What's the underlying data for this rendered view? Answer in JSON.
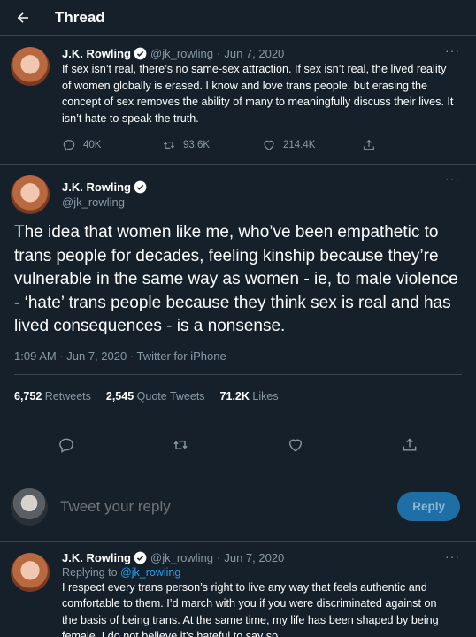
{
  "header": {
    "title": "Thread"
  },
  "tweet1": {
    "name": "J.K. Rowling",
    "handle": "@jk_rowling",
    "dot": "·",
    "date": "Jun 7, 2020",
    "text": "If sex isn’t real, there’s no same-sex attraction. If sex isn’t real, the lived reality of women globally is erased. I know and love trans people, but erasing the concept of sex removes the ability of many to meaningfully discuss their lives. It isn’t hate to speak the truth.",
    "replies": "40K",
    "retweets": "93.6K",
    "likes": "214.4K"
  },
  "tweet2": {
    "name": "J.K. Rowling",
    "handle": "@jk_rowling",
    "text": "The idea that women like me, who’ve been empathetic to trans people for decades, feeling kinship because they’re vulnerable in the same way as women - ie, to male violence - ‘hate’ trans people because they think sex is real and has lived consequences - is a nonsense.",
    "meta": "1:09 AM · Jun 7, 2020 · Twitter for iPhone",
    "retweets_count": "6,752",
    "retweets_label": "Retweets",
    "quotes_count": "2,545",
    "quotes_label": "Quote Tweets",
    "likes_count": "71.2K",
    "likes_label": "Likes"
  },
  "reply": {
    "placeholder": "Tweet your reply",
    "button": "Reply"
  },
  "tweet3": {
    "name": "J.K. Rowling",
    "handle": "@jk_rowling",
    "dot": "·",
    "date": "Jun 7, 2020",
    "replying_prefix": "Replying to",
    "replying_to": "@jk_rowling",
    "text": "I respect every trans person’s right to live any way that feels authentic and comfortable to them. I’d march with you if you were discriminated against on the basis of being trans. At the same time, my life has been shaped by being female. I do not believe it’s hateful to say so."
  },
  "more_label": "···",
  "colors": {
    "background": "#15202b",
    "accent": "#1da1f2",
    "muted": "#8899a6",
    "border": "#38444d"
  }
}
